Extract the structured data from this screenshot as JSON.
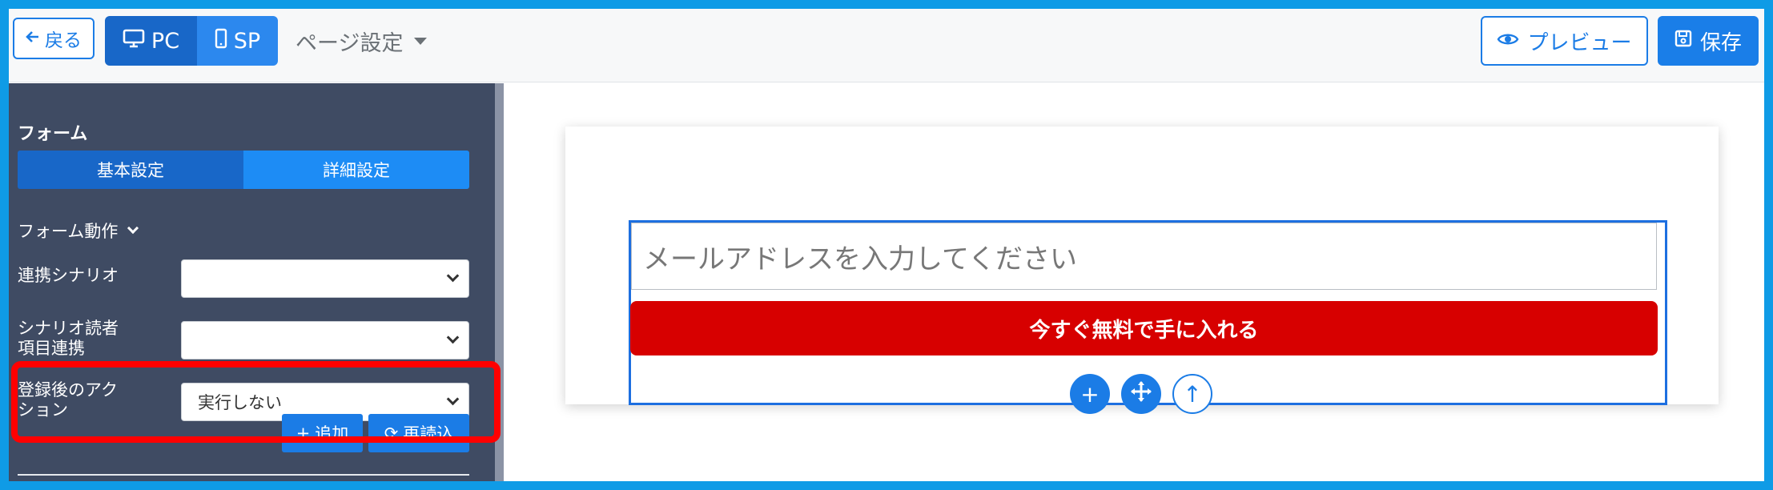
{
  "topbar": {
    "back_label": "戻る",
    "device_pc": "PC",
    "device_sp": "SP",
    "page_settings": "ページ設定",
    "preview_label": "プレビュー",
    "save_label": "保存"
  },
  "sidebar": {
    "section_title": "フォーム",
    "tabs": [
      {
        "label": "基本設定",
        "active": true
      },
      {
        "label": "詳細設定",
        "active": false
      }
    ],
    "group_label": "フォーム動作",
    "fields": [
      {
        "label": "連携シナリオ",
        "value": ""
      },
      {
        "label": "シナリオ読者\n項目連携",
        "value": ""
      },
      {
        "label": "登録後のアク\nション",
        "value": "実行しない"
      }
    ],
    "buttons": {
      "add": "追加",
      "reload": "再読込"
    }
  },
  "canvas": {
    "email_placeholder": "メールアドレスを入力してください",
    "cta_label": "今すぐ無料で手に入れる",
    "add_symbol": "+",
    "up_symbol": "↑"
  },
  "colors": {
    "primary": "#1b7ce6",
    "sidebar_bg": "#3f4b63",
    "cta_red": "#d70000",
    "highlight_red": "#ff0000"
  }
}
